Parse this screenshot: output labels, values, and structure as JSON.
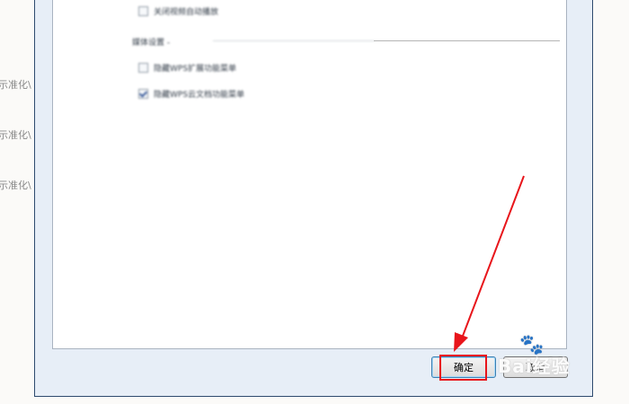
{
  "side_labels": [
    "示准化\\",
    "示准化\\",
    "示准化\\"
  ],
  "options": {
    "top_option": "关闭视频自动播放",
    "group_title": "媒体设置 -",
    "option_1": "隐藏WPS扩展功能菜单",
    "option_2": "隐藏WPS云文档功能菜单"
  },
  "buttons": {
    "ok_label": "确定",
    "cancel_label": "取消"
  },
  "watermark": {
    "text": "Bai经验"
  },
  "colors": {
    "annotation_red": "#e8151b",
    "dialog_border": "#2e4a6e"
  }
}
